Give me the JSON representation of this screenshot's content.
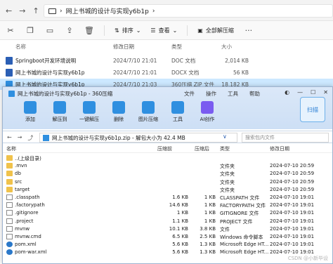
{
  "explorer": {
    "address_parts": [
      "网上书城的设计与实现y6b1p"
    ],
    "toolbar": {
      "sort": "排序",
      "view": "查看",
      "extract_all": "全部解压缩"
    },
    "columns": {
      "name": "名称",
      "date": "修改日期",
      "type": "类型",
      "size": "大小"
    },
    "files": [
      {
        "name": "Springboot开发环境说明",
        "date": "2024/7/10 21:01",
        "type": "DOC 文档",
        "size": "2,014 KB",
        "selected": false
      },
      {
        "name": "网上书城的设计与实现y6b1p",
        "date": "2024/7/10 21:01",
        "type": "DOCX 文档",
        "size": "56 KB",
        "selected": false
      },
      {
        "name": "网上书城的设计与实现y6b1p",
        "date": "2024/7/10 21:03",
        "type": "360压缩 ZIP 文件",
        "size": "18,182 KB",
        "selected": true
      }
    ]
  },
  "archiver": {
    "title": "网上书城的设计与实现y6b1p - 360压缩",
    "menus": [
      "文件",
      "操作",
      "工具",
      "帮助"
    ],
    "tools": [
      {
        "label": "添加",
        "color": "#2f8fe0"
      },
      {
        "label": "解压到",
        "color": "#2f8fe0"
      },
      {
        "label": "一键解压",
        "color": "#2f8fe0"
      },
      {
        "label": "删除",
        "color": "#2f8fe0"
      },
      {
        "label": "图片压缩",
        "color": "#2f8fe0"
      },
      {
        "label": "工具",
        "color": "#2f8fe0"
      },
      {
        "label": "AI创作",
        "color": "#7a5cf0"
      }
    ],
    "scan_label": "扫描",
    "path_text": "网上书城的设计与实现y6b1p.zip - 解包大小为 42.4 MB",
    "search_placeholder": "搜索包内文件",
    "columns": {
      "name": "名称",
      "orig": "压缩前",
      "comp": "压缩后",
      "type": "类型",
      "date": "修改日期"
    },
    "rows": [
      {
        "name": "..(上级目录)",
        "orig": "",
        "comp": "",
        "type": "",
        "date": "",
        "icon": "folder"
      },
      {
        "name": ".mvn",
        "orig": "",
        "comp": "",
        "type": "文件夹",
        "date": "2024-07-10 20:59",
        "icon": "folder"
      },
      {
        "name": "db",
        "orig": "",
        "comp": "",
        "type": "文件夹",
        "date": "2024-07-10 20:59",
        "icon": "folder"
      },
      {
        "name": "src",
        "orig": "",
        "comp": "",
        "type": "文件夹",
        "date": "2024-07-10 20:59",
        "icon": "folder"
      },
      {
        "name": "target",
        "orig": "",
        "comp": "",
        "type": "文件夹",
        "date": "2024-07-10 20:59",
        "icon": "folder"
      },
      {
        "name": ".classpath",
        "orig": "1.6 KB",
        "comp": "1 KB",
        "type": "CLASSPATH 文件",
        "date": "2024-07-10 19:01",
        "icon": "file"
      },
      {
        "name": ".factorypath",
        "orig": "14.6 KB",
        "comp": "1 KB",
        "type": "FACTORYPATH 文件",
        "date": "2024-07-10 19:01",
        "icon": "file"
      },
      {
        "name": ".gitignore",
        "orig": "1 KB",
        "comp": "1 KB",
        "type": "GITIGNORE 文件",
        "date": "2024-07-10 19:01",
        "icon": "file"
      },
      {
        "name": ".project",
        "orig": "1.1 KB",
        "comp": "1 KB",
        "type": "PROJECT 文件",
        "date": "2024-07-10 19:01",
        "icon": "file"
      },
      {
        "name": "mvnw",
        "orig": "10.1 KB",
        "comp": "3.8 KB",
        "type": "文件",
        "date": "2024-07-10 19:01",
        "icon": "file"
      },
      {
        "name": "mvnw.cmd",
        "orig": "6.5 KB",
        "comp": "2.5 KB",
        "type": "Windows 命令脚本",
        "date": "2024-07-10 19:01",
        "icon": "file"
      },
      {
        "name": "pom.xml",
        "orig": "5.6 KB",
        "comp": "1.3 KB",
        "type": "Microsoft Edge HT...",
        "date": "2024-07-10 19:01",
        "icon": "xml"
      },
      {
        "name": "pom-war.xml",
        "orig": "5.6 KB",
        "comp": "1.3 KB",
        "type": "Microsoft Edge HT...",
        "date": "2024-07-10 19:01",
        "icon": "xml"
      }
    ],
    "watermark": "CSDN @小新毕设"
  }
}
